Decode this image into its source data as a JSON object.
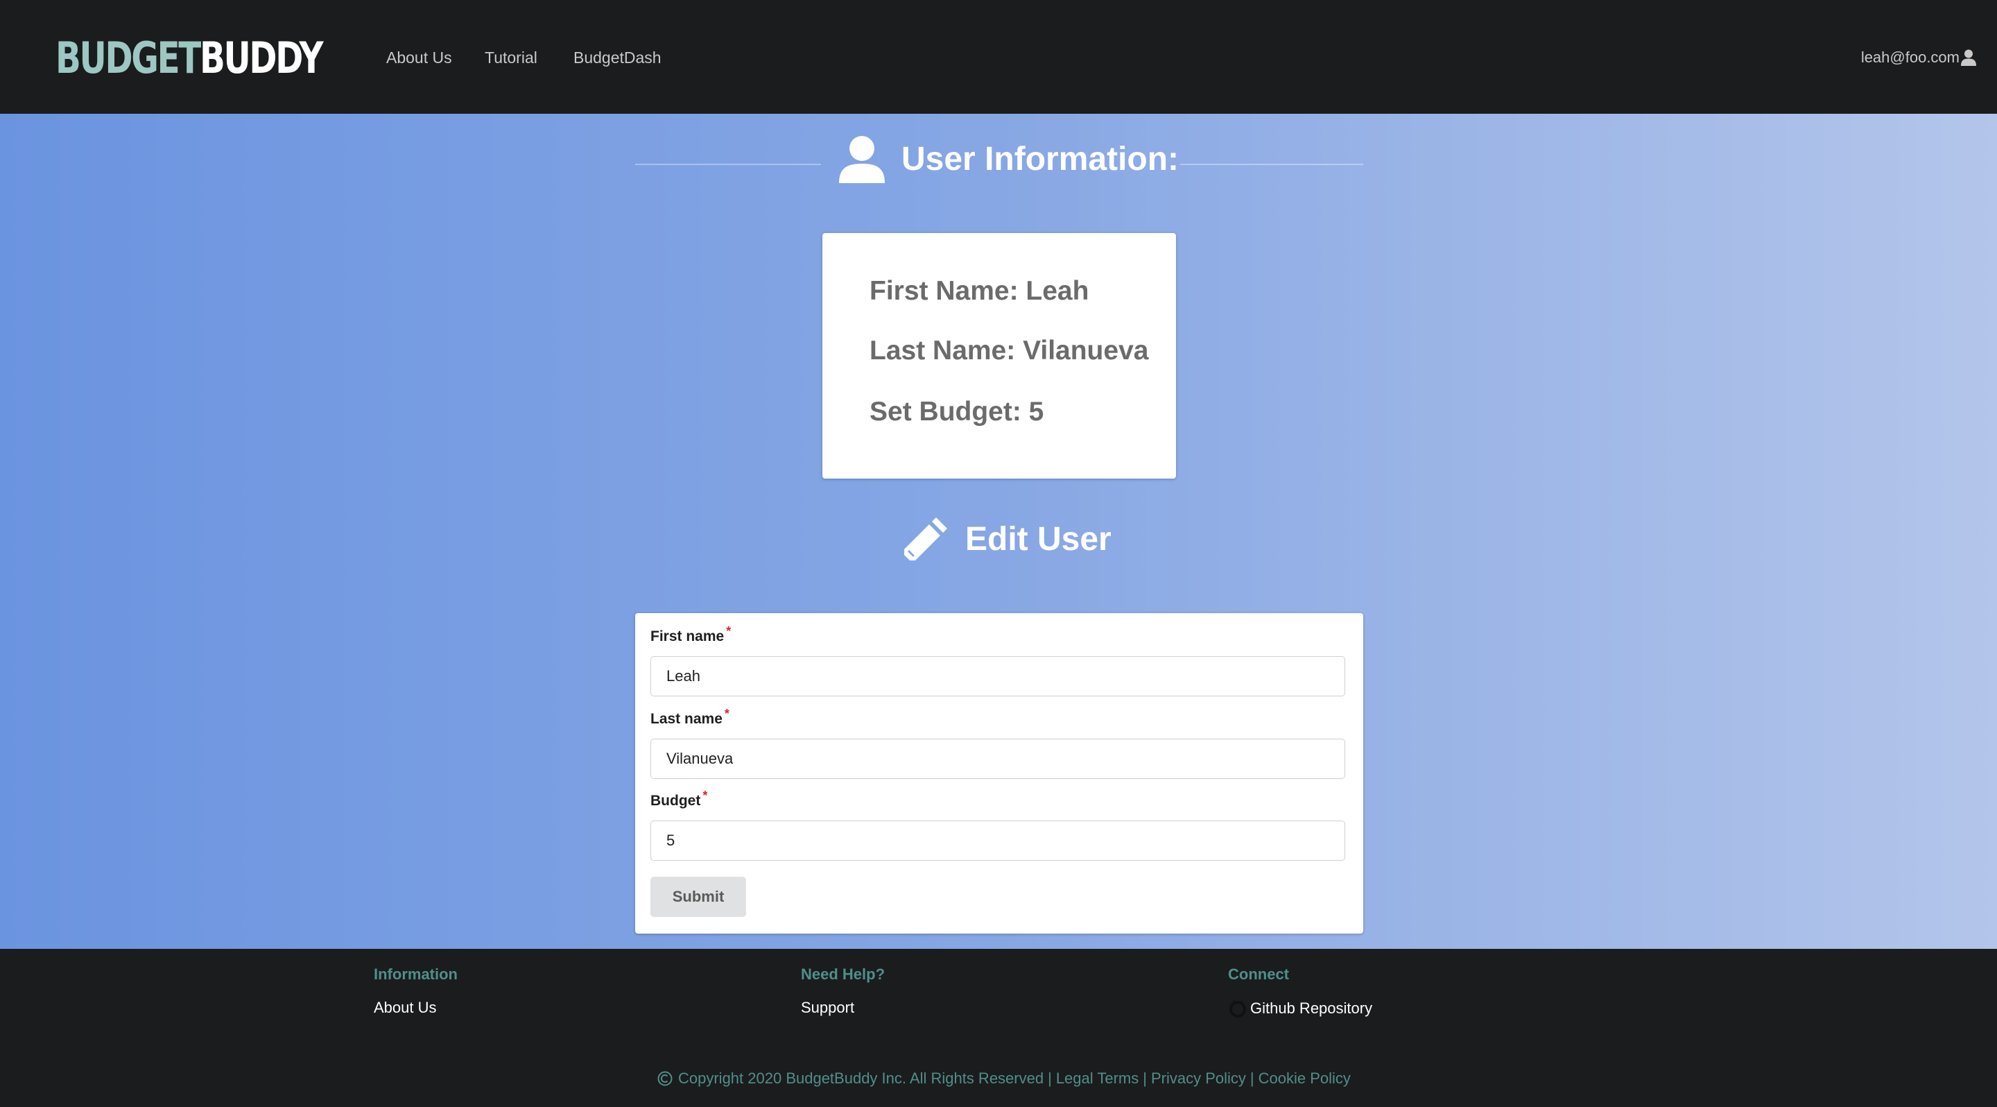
{
  "header": {
    "logo_part1": "BUDGET",
    "logo_part2": "BUDDY",
    "nav": [
      "About Us",
      "Tutorial",
      "BudgetDash"
    ],
    "user_email": "leah@foo.com",
    "user_icon": "user-icon"
  },
  "user_info": {
    "heading": "User Information:",
    "heading_icon": "user-icon",
    "first_name": "First Name: Leah",
    "last_name": "Last Name: Vilanueva",
    "budget": "Set Budget: 5"
  },
  "edit_user": {
    "heading": "Edit User",
    "heading_icon": "pencil-icon",
    "fields": [
      {
        "label": "First name",
        "required_mark": "*",
        "value": "Leah"
      },
      {
        "label": "Last name",
        "required_mark": "*",
        "value": "Vilanueva"
      },
      {
        "label": "Budget",
        "required_mark": "*",
        "value": "5"
      }
    ],
    "submit_label": "Submit"
  },
  "footer": {
    "columns": [
      {
        "heading": "Information",
        "link": "About Us"
      },
      {
        "heading": "Need Help?",
        "link": "Support"
      },
      {
        "heading": "Connect",
        "link": "Github Repository",
        "icon": "github-icon"
      }
    ],
    "copyright": "Copyright 2020 BudgetBuddy Inc. All Rights Reserved",
    "separator": "|",
    "legal": "Legal Terms",
    "privacy": "Privacy Policy",
    "cookie": "Cookie Policy"
  },
  "colors": {
    "topbar": "#1b1c1d",
    "logo_accent": "#9cc7c2",
    "footer_accent": "#4f8f8c",
    "required": "#db2828"
  }
}
